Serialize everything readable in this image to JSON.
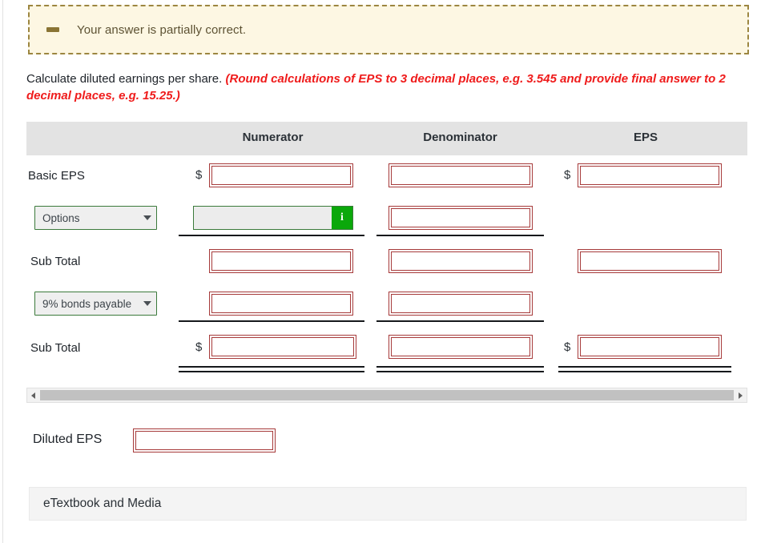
{
  "alert": {
    "icon": "minus-dash-icon",
    "message": "Your answer is partially correct."
  },
  "question": {
    "prompt": "Calculate diluted earnings per share.",
    "hint": "(Round calculations of EPS to 3 decimal places, e.g. 3.545 and provide final answer to 2 decimal places, e.g. 15.25.)"
  },
  "table": {
    "headers": {
      "numerator": "Numerator",
      "denominator": "Denominator",
      "eps": "EPS"
    },
    "rows": [
      {
        "label": "Basic EPS",
        "numerator_prefix": "$",
        "numerator_value": "",
        "denominator_value": "",
        "eps_prefix": "$",
        "eps_value": ""
      },
      {
        "label": "Options",
        "select_value": "Options",
        "numerator_value": "",
        "info_label": "i",
        "denominator_value": ""
      },
      {
        "label": "Sub Total",
        "numerator_prefix": "",
        "numerator_value": "",
        "denominator_value": "",
        "eps_prefix": "",
        "eps_value": ""
      },
      {
        "label": "9% bonds payable",
        "select_value": "9% bonds payable",
        "numerator_value": "",
        "denominator_value": ""
      },
      {
        "label": "Sub Total",
        "numerator_prefix": "$",
        "numerator_value": "",
        "denominator_value": "",
        "eps_prefix": "$",
        "eps_value": ""
      }
    ]
  },
  "scrollbar": {
    "left_arrow": "scroll-left-arrow",
    "right_arrow": "scroll-right-arrow"
  },
  "diluted": {
    "label": "Diluted EPS",
    "value": ""
  },
  "etextbook": {
    "label": "eTextbook and Media"
  },
  "colors": {
    "alert_bg": "#fdf7e3",
    "alert_border": "#9c8640",
    "hint_red": "#ef1b1b",
    "input_red": "#a63a3a",
    "select_green": "#3b7a3b",
    "info_green": "#0ba80b",
    "header_grey": "#e3e3e3"
  }
}
